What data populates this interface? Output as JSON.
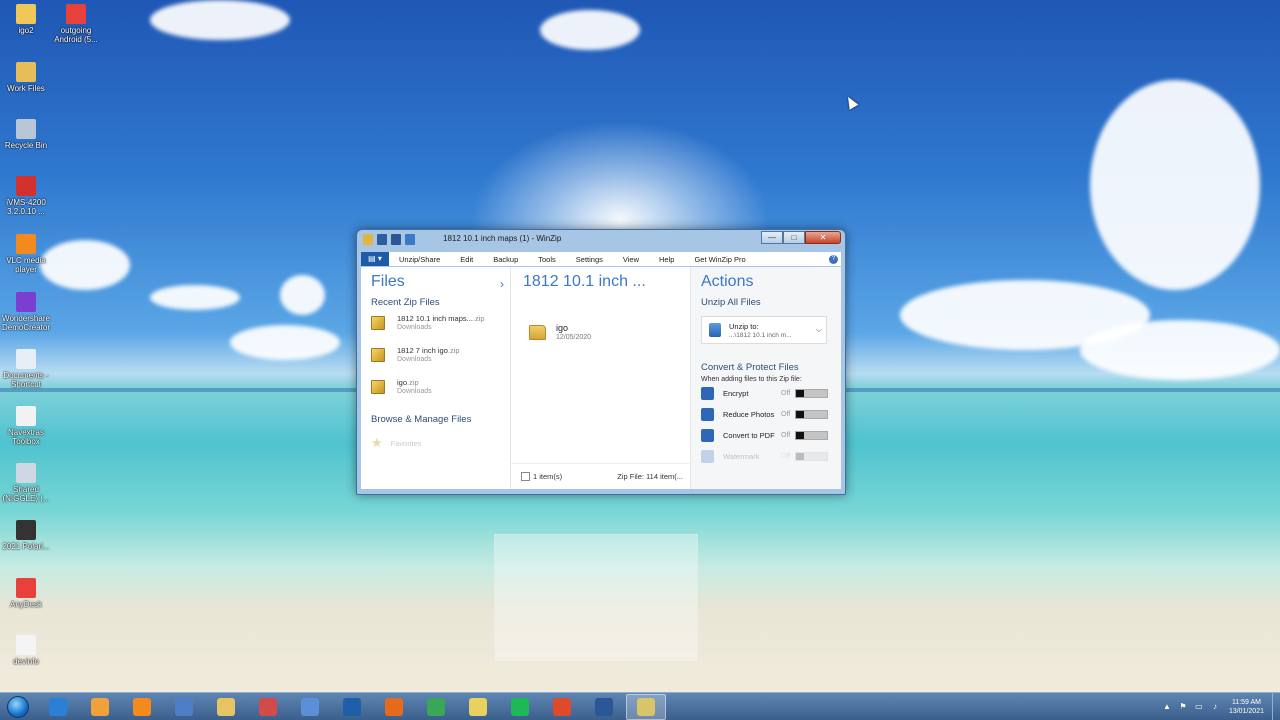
{
  "desktop": {
    "icons": [
      {
        "label": "igo2",
        "icon": "file-icon",
        "color": "#f0c85a"
      },
      {
        "label": "outgoing Android (5...",
        "icon": "anydesk-icon",
        "color": "#e8413b"
      },
      {
        "label": "Work Files",
        "icon": "folder-icon",
        "color": "#e6bd57"
      },
      {
        "label": "Recycle Bin",
        "icon": "recycle-bin-icon",
        "color": "#b8c7d6"
      },
      {
        "label": "iVMS-4200 3.2.0.10 ...",
        "icon": "ivms-icon",
        "color": "#d3312d"
      },
      {
        "label": "VLC media player",
        "icon": "vlc-icon",
        "color": "#f28a1e"
      },
      {
        "label": "Wondershare DemoCreator",
        "icon": "democreator-icon",
        "color": "#7a3fd1"
      },
      {
        "label": "Documents - Shortcut",
        "icon": "shortcut-icon",
        "color": "#e8eef6"
      },
      {
        "label": "Navextras Toolbox",
        "icon": "toolbox-icon",
        "color": "#f2f2f2"
      },
      {
        "label": "Shared (NIGGLE) (...",
        "icon": "network-drive-icon",
        "color": "#cfd8e2"
      },
      {
        "label": "2021 Polari...",
        "icon": "document-icon",
        "color": "#333333"
      },
      {
        "label": "AnyDesk",
        "icon": "anydesk-icon",
        "color": "#e8413b"
      },
      {
        "label": "devinfo",
        "icon": "text-file-icon",
        "color": "#f4f4f4"
      }
    ]
  },
  "window": {
    "title": "1812 10.1 inch maps (1) - WinZip",
    "controls": {
      "minimize": "—",
      "maximize": "□",
      "close": "✕"
    },
    "menu": [
      "Unzip/Share",
      "Edit",
      "Backup",
      "Tools",
      "Settings",
      "View",
      "Help",
      "Get WinZip Pro"
    ],
    "help_glyph": "?",
    "files_pane": {
      "heading": "Files",
      "chevron": "›",
      "recent_heading": "Recent Zip Files",
      "recent": [
        {
          "name": "1812 10.1 inch maps...",
          "ext": ".zip",
          "location": "Downloads"
        },
        {
          "name": "1812 7 inch igo",
          "ext": ".zip",
          "location": "Downloads"
        },
        {
          "name": "igo",
          "ext": ".zip",
          "location": "Downloads"
        }
      ],
      "browse_heading": "Browse & Manage Files",
      "favorites": "Favorites"
    },
    "main_pane": {
      "title": "1812 10.1 inch ...",
      "items": [
        {
          "name": "igo",
          "date": "12/05/2020"
        }
      ],
      "selection": "1 item(s)",
      "zip_info": "Zip File: 114 item(..."
    },
    "actions_pane": {
      "heading": "Actions",
      "unzip_heading": "Unzip All Files",
      "unzip_to_label": "Unzip to:",
      "unzip_to_path": "...\\1812 10.1 inch m...",
      "dropdown": "⌵",
      "convert_heading": "Convert & Protect Files",
      "convert_sub": "When adding files to this Zip file:",
      "options": [
        {
          "label": "Encrypt",
          "state": "Off",
          "icon": "lock-icon"
        },
        {
          "label": "Reduce Photos",
          "state": "Off",
          "icon": "photo-icon"
        },
        {
          "label": "Convert to PDF",
          "state": "Off",
          "icon": "pdf-icon"
        },
        {
          "label": "Watermark",
          "state": "Off",
          "icon": "watermark-icon"
        }
      ]
    }
  },
  "taskbar": {
    "apps": [
      {
        "name": "ie-icon",
        "color": "#2b7fd6"
      },
      {
        "name": "media-player-icon",
        "color": "#f0a13a"
      },
      {
        "name": "vlc-icon",
        "color": "#f28a1e"
      },
      {
        "name": "network-icon",
        "color": "#4e7fc4"
      },
      {
        "name": "file-explorer-icon",
        "color": "#e7c463"
      },
      {
        "name": "snipping-icon",
        "color": "#d24a4a"
      },
      {
        "name": "paint-icon",
        "color": "#5b8fd6"
      },
      {
        "name": "outlook-icon",
        "color": "#1f5ea8"
      },
      {
        "name": "firefox-icon",
        "color": "#e66a1d"
      },
      {
        "name": "chrome-icon",
        "color": "#3aa757"
      },
      {
        "name": "folder-icon",
        "color": "#e7d15f"
      },
      {
        "name": "spotify-icon",
        "color": "#1db954"
      },
      {
        "name": "record-icon",
        "color": "#e04a2c"
      },
      {
        "name": "word-icon",
        "color": "#2b5797"
      },
      {
        "name": "winzip-icon",
        "color": "#d8c56a"
      }
    ],
    "tray_icons": [
      "▲",
      "⚑",
      "▭",
      "♪"
    ],
    "time": "11:59 AM",
    "date": "13/01/2021"
  }
}
